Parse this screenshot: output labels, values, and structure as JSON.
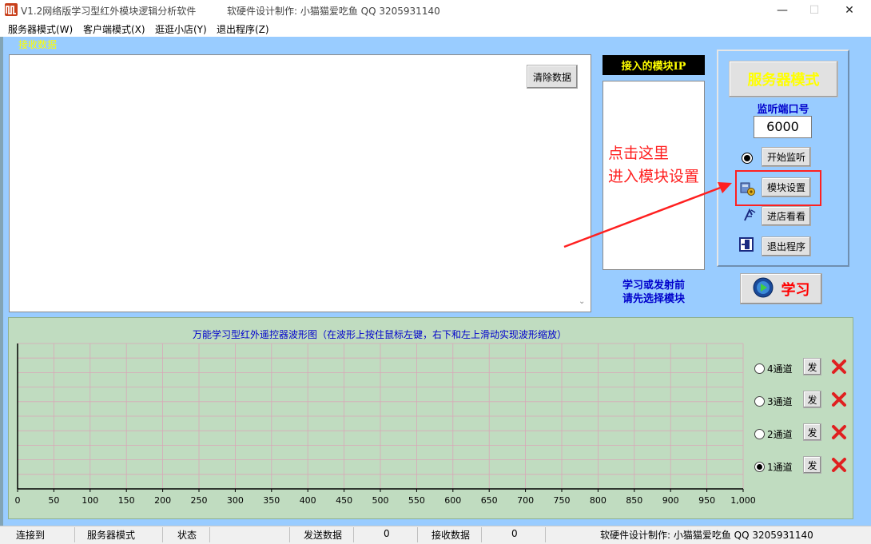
{
  "window": {
    "title": "V1.2网络版学习型红外模块逻辑分析软件",
    "credit": "软硬件设计制作:  小猫猫爱吃鱼  QQ  3205931140",
    "minimize": "—",
    "maximize": "☐",
    "close": "✕"
  },
  "menu": [
    "服务器模式(W)",
    "客户端模式(X)",
    "逛逛小店(Y)",
    "退出程序(Z)"
  ],
  "receive": {
    "label": "接收数据",
    "clear_button": "清除数据"
  },
  "ip_panel": {
    "header": "接入的模块IP",
    "tip_line1": "学习或发射前",
    "tip_line2": "请先选择模块"
  },
  "server_panel": {
    "mode_button": "服务器模式",
    "port_label": "监听端口号",
    "port_value": "6000",
    "listen_button": "开始监听",
    "module_button": "模块设置",
    "shop_button": "进店看看",
    "exit_button": "退出程序",
    "learn_button": "学习"
  },
  "annotation": {
    "line1": "点击这里",
    "line2": "进入模块设置",
    "color": "#ff2020"
  },
  "waveform": {
    "title": "万能学习型红外遥控器波形图（在波形上按住鼠标左键，右下和左上滑动实现波形缩放）",
    "x_ticks": [
      "0",
      "50",
      "100",
      "150",
      "200",
      "250",
      "300",
      "350",
      "400",
      "450",
      "500",
      "550",
      "600",
      "650",
      "700",
      "750",
      "800",
      "850",
      "900",
      "950",
      "1,000"
    ],
    "channels": [
      {
        "label": "4通道",
        "send": "发",
        "selected": false
      },
      {
        "label": "3通道",
        "send": "发",
        "selected": false
      },
      {
        "label": "2通道",
        "send": "发",
        "selected": false
      },
      {
        "label": "1通道",
        "send": "发",
        "selected": true
      }
    ]
  },
  "status": {
    "connected_label": "连接到",
    "mode": "服务器模式",
    "state_label": "状态",
    "sent_label": "发送数据",
    "sent_value": "0",
    "recv_label": "接收数据",
    "recv_value": "0",
    "credit": "软硬件设计制作:  小猫猫爱吃鱼  QQ  3205931140"
  },
  "colors": {
    "client_bg": "#99ccff",
    "wave_bg": "#c0dcc0",
    "accent_yellow": "#ffff00",
    "accent_blue": "#0000cc",
    "accent_red": "#ff0000"
  }
}
